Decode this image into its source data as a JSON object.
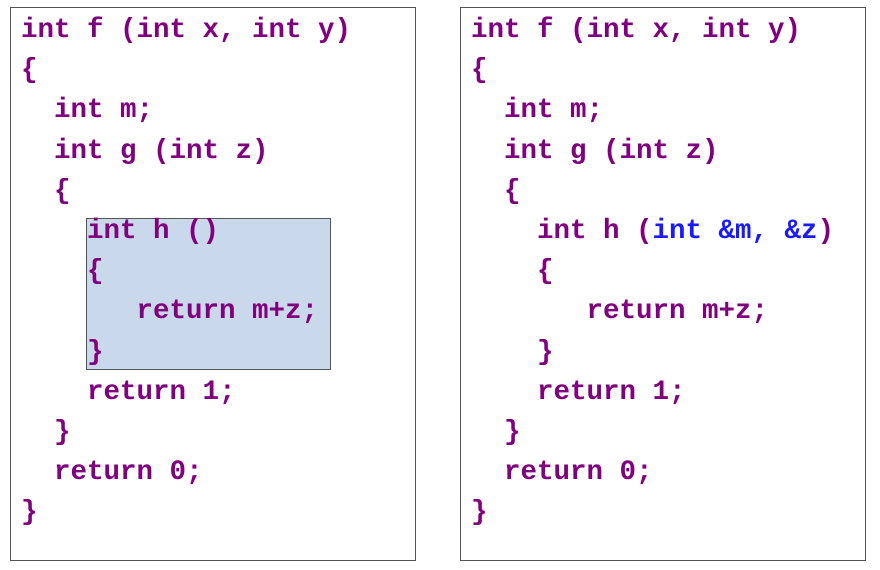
{
  "colors": {
    "code": "#800080",
    "highlight_param": "#1a1aff",
    "highlight_bg": "#c9d8ea"
  },
  "left": {
    "lines": [
      {
        "indent": 0,
        "text": "int f (int x, int y)"
      },
      {
        "indent": 0,
        "text": "{"
      },
      {
        "indent": 2,
        "text": "int m;"
      },
      {
        "indent": 2,
        "text": "int g (int z)"
      },
      {
        "indent": 2,
        "text": "{"
      },
      {
        "indent": 4,
        "text": "int h ()"
      },
      {
        "indent": 4,
        "text": "{"
      },
      {
        "indent": 7,
        "text": "return m+z;"
      },
      {
        "indent": 4,
        "text": "}"
      },
      {
        "indent": 4,
        "text": "return 1;"
      },
      {
        "indent": 2,
        "text": "}"
      },
      {
        "indent": 2,
        "text": "return 0;"
      },
      {
        "indent": 0,
        "text": "}"
      }
    ]
  },
  "right": {
    "lines": [
      {
        "indent": 0,
        "text": "int f (int x, int y)"
      },
      {
        "indent": 0,
        "text": "{"
      },
      {
        "indent": 2,
        "text": "int m;"
      },
      {
        "indent": 2,
        "text": "int g (int z)"
      },
      {
        "indent": 2,
        "text": "{"
      },
      {
        "indent": 4,
        "text": "int h (",
        "param": "int &m, &z",
        "tail": ")"
      },
      {
        "indent": 4,
        "text": "{"
      },
      {
        "indent": 7,
        "text": "return m+z;"
      },
      {
        "indent": 4,
        "text": "}"
      },
      {
        "indent": 4,
        "text": "return 1;"
      },
      {
        "indent": 2,
        "text": "}"
      },
      {
        "indent": 2,
        "text": "return 0;"
      },
      {
        "indent": 0,
        "text": "}"
      }
    ]
  }
}
